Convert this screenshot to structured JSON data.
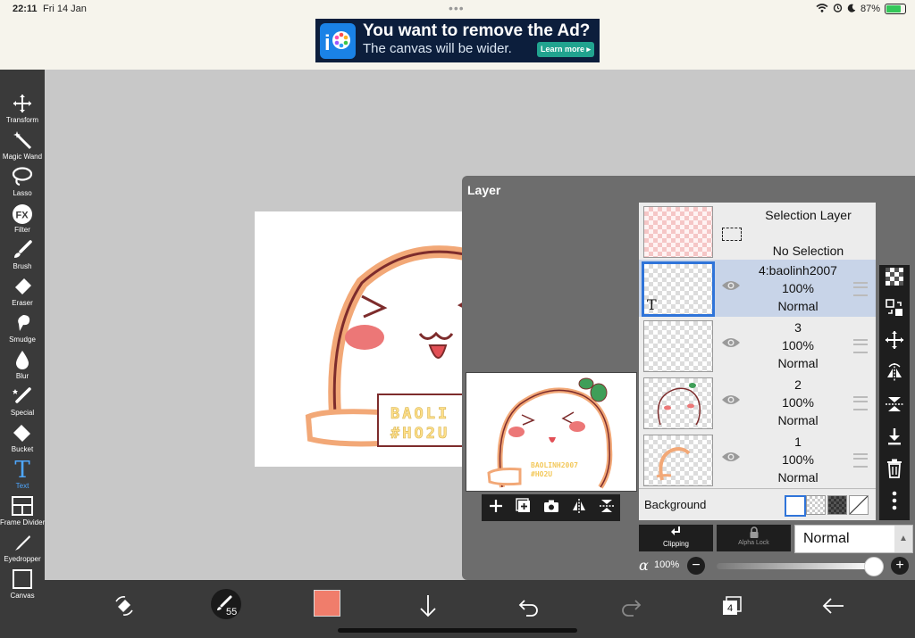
{
  "status_bar": {
    "time": "22:11",
    "date": "Fri 14 Jan",
    "battery": "87%",
    "battery_level": 0.87
  },
  "ad": {
    "title": "You want to remove the Ad?",
    "subtitle": "The canvas will be wider.",
    "button": "Learn more ▸"
  },
  "tools": [
    {
      "label": "Transform",
      "icon": "transform-icon"
    },
    {
      "label": "Magic Wand",
      "icon": "magic-wand-icon"
    },
    {
      "label": "Lasso",
      "icon": "lasso-icon"
    },
    {
      "label": "Filter",
      "icon": "filter-icon"
    },
    {
      "label": "Brush",
      "icon": "brush-icon"
    },
    {
      "label": "Eraser",
      "icon": "eraser-icon"
    },
    {
      "label": "Smudge",
      "icon": "smudge-icon"
    },
    {
      "label": "Blur",
      "icon": "blur-icon"
    },
    {
      "label": "Special",
      "icon": "special-icon"
    },
    {
      "label": "Bucket",
      "icon": "bucket-icon"
    },
    {
      "label": "Text",
      "icon": "text-icon",
      "active": true
    },
    {
      "label": "Frame Divider",
      "icon": "frame-divider-icon"
    },
    {
      "label": "Eyedropper",
      "icon": "eyedropper-icon"
    },
    {
      "label": "Canvas",
      "icon": "canvas-icon"
    }
  ],
  "layer_panel": {
    "title": "Layer",
    "selection_layer": {
      "name": "Selection Layer",
      "status": "No Selection"
    },
    "layers": [
      {
        "name": "4:baolinh2007",
        "opacity": "100%",
        "mode": "Normal",
        "selected": true,
        "type": "text"
      },
      {
        "name": "3",
        "opacity": "100%",
        "mode": "Normal"
      },
      {
        "name": "2",
        "opacity": "100%",
        "mode": "Normal"
      },
      {
        "name": "1",
        "opacity": "100%",
        "mode": "Normal"
      }
    ],
    "background_label": "Background",
    "clipping_label": "Clipping",
    "alpha_lock_label": "Alpha Lock",
    "blend_mode": "Normal",
    "alpha_symbol": "α",
    "alpha_value": "100%",
    "layer_text_thumb": "T"
  },
  "artwork": {
    "text_line1": "BAOLI",
    "text_line2": "#HO2U",
    "preview_text1": "BAOLINH2007",
    "preview_text2": "#HO2U"
  },
  "bottom_toolbar": {
    "brush_size": "55",
    "color": "#f07d6b",
    "layer_count": "4"
  },
  "colors": {
    "accent": "#2f74d9",
    "toolbar_bg": "#3a3a3a",
    "panel_bg": "#6d6d6d"
  }
}
